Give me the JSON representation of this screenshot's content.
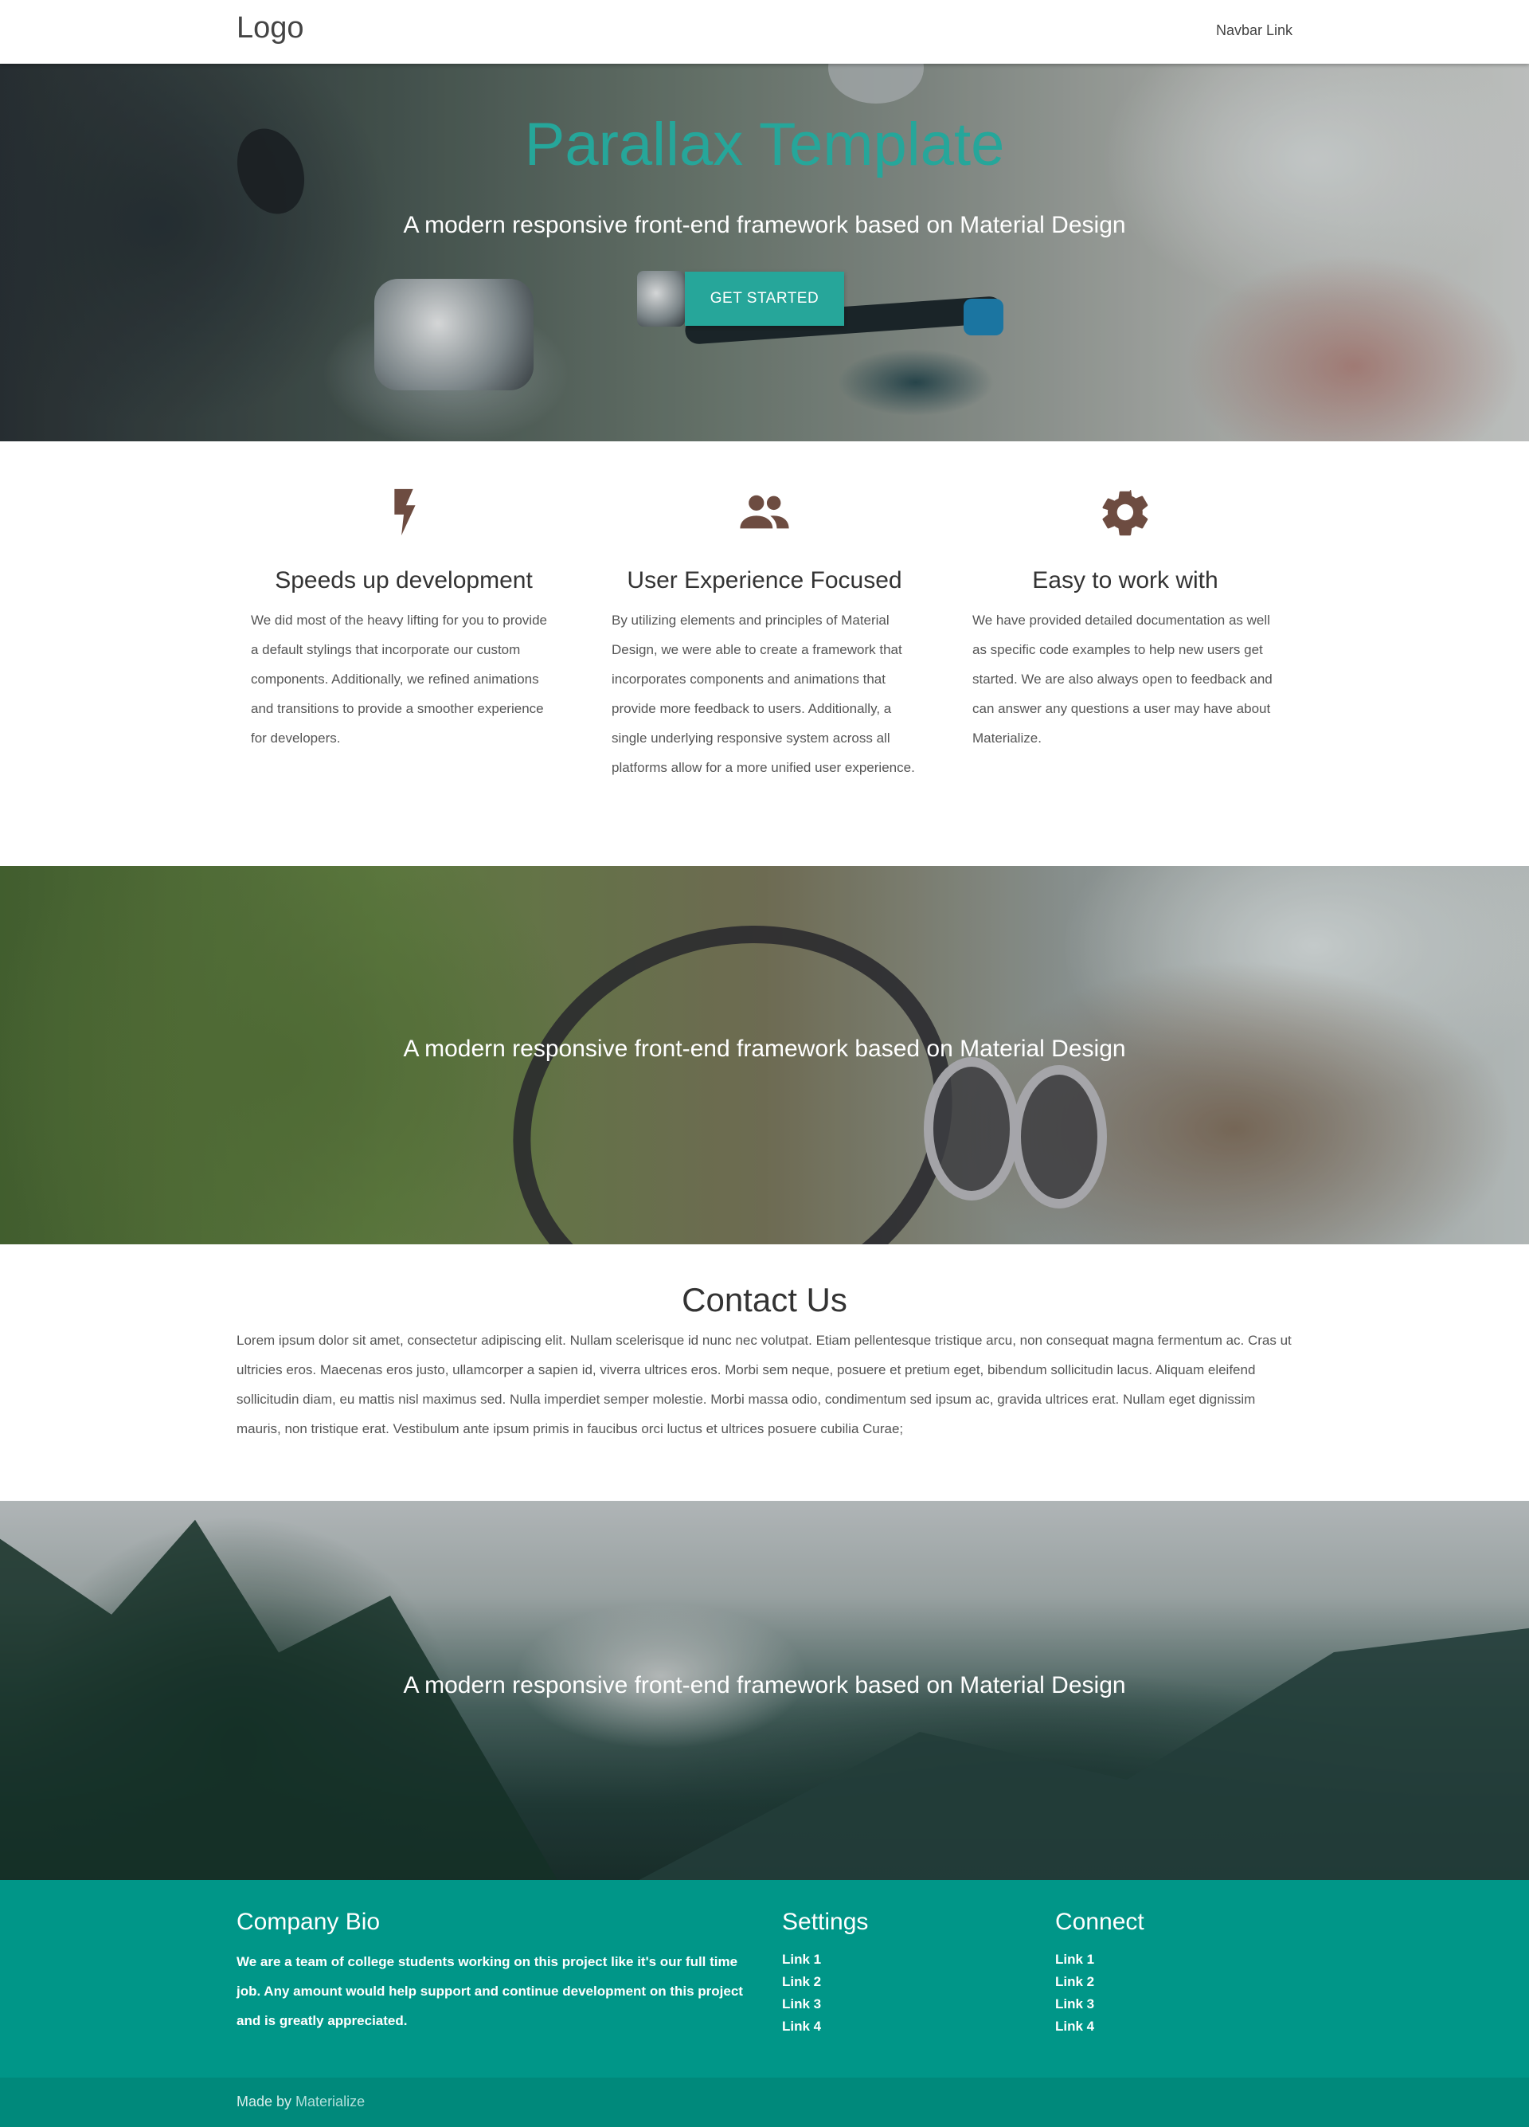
{
  "nav": {
    "logo": "Logo",
    "link": "Navbar Link"
  },
  "hero": {
    "title": "Parallax Template",
    "subtitle": "A modern responsive front-end framework based on Material Design",
    "button": "GET STARTED"
  },
  "features": [
    {
      "icon": "bolt-icon",
      "title": "Speeds up development",
      "text": "We did most of the heavy lifting for you to provide a default stylings that incorporate our custom components. Additionally, we refined animations and transitions to provide a smoother experience for developers."
    },
    {
      "icon": "group-icon",
      "title": "User Experience Focused",
      "text": "By utilizing elements and principles of Material Design, we were able to create a framework that incorporates components and animations that provide more feedback to users. Additionally, a single underlying responsive system across all platforms allow for a more unified user experience."
    },
    {
      "icon": "settings-icon",
      "title": "Easy to work with",
      "text": "We have provided detailed documentation as well as specific code examples to help new users get started. We are also always open to feedback and can answer any questions a user may have about Materialize."
    }
  ],
  "section2": {
    "caption": "A modern responsive front-end framework based on Material Design"
  },
  "contact": {
    "title": "Contact Us",
    "text": "Lorem ipsum dolor sit amet, consectetur adipiscing elit. Nullam scelerisque id nunc nec volutpat. Etiam pellentesque tristique arcu, non consequat magna fermentum ac. Cras ut ultricies eros. Maecenas eros justo, ullamcorper a sapien id, viverra ultrices eros. Morbi sem neque, posuere et pretium eget, bibendum sollicitudin lacus. Aliquam eleifend sollicitudin diam, eu mattis nisl maximus sed. Nulla imperdiet semper molestie. Morbi massa odio, condimentum sed ipsum ac, gravida ultrices erat. Nullam eget dignissim mauris, non tristique erat. Vestibulum ante ipsum primis in faucibus orci luctus et ultrices posuere cubilia Curae;"
  },
  "section3": {
    "caption": "A modern responsive front-end framework based on Material Design"
  },
  "footer": {
    "bio_title": "Company Bio",
    "bio_text": "We are a team of college students working on this project like it's our full time job. Any amount would help support and continue development on this project and is greatly appreciated.",
    "settings_title": "Settings",
    "settings_links": [
      "Link 1",
      "Link 2",
      "Link 3",
      "Link 4"
    ],
    "connect_title": "Connect",
    "connect_links": [
      "Link 1",
      "Link 2",
      "Link 3",
      "Link 4"
    ],
    "made_by": "Made by",
    "made_by_link": "Materialize"
  },
  "colors": {
    "teal": "#26a69a",
    "footer": "#009688",
    "footer_copy": "#00897b",
    "icon_brown": "#6d4c41"
  }
}
